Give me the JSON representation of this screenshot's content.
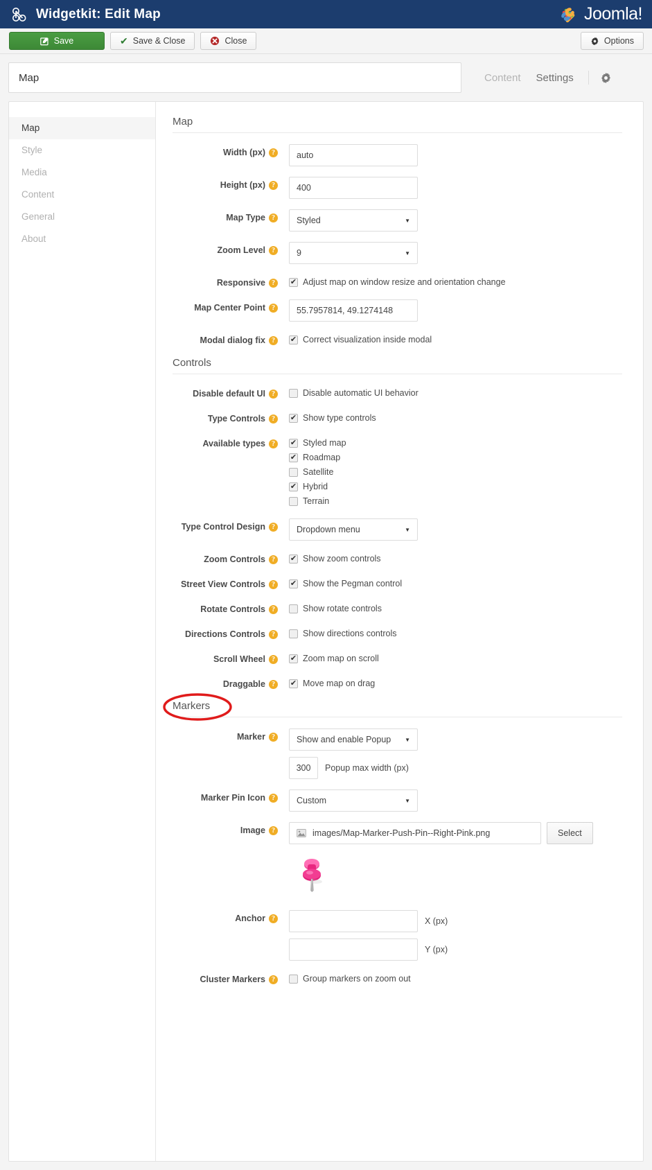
{
  "header": {
    "app_title": "Widgetkit: Edit Map",
    "brand": "Joomla!",
    "brand_mark": "joomla-logo-icon",
    "widgetkit_icon": "widgetkit-icon"
  },
  "toolbar": {
    "save_label": "Save",
    "save_close_label": "Save & Close",
    "close_label": "Close",
    "options_label": "Options"
  },
  "titlebar": {
    "value": "Map",
    "tabs": [
      {
        "label": "Content",
        "active": false
      },
      {
        "label": "Settings",
        "active": true
      }
    ],
    "gear_icon": "gear-icon"
  },
  "sidebar": {
    "items": [
      {
        "label": "Map",
        "active": true
      },
      {
        "label": "Style",
        "active": false
      },
      {
        "label": "Media",
        "active": false
      },
      {
        "label": "Content",
        "active": false
      },
      {
        "label": "General",
        "active": false
      },
      {
        "label": "About",
        "active": false
      }
    ]
  },
  "annotation": {
    "shape": "ellipse",
    "color": "#e01b1b",
    "target": "Markers"
  },
  "sections": {
    "map": {
      "title": "Map",
      "width_label": "Width (px)",
      "width_value": "auto",
      "height_label": "Height (px)",
      "height_value": "400",
      "map_type_label": "Map Type",
      "map_type_value": "Styled",
      "zoom_level_label": "Zoom Level",
      "zoom_level_value": "9",
      "responsive_label": "Responsive",
      "responsive_text": "Adjust map on window resize and orientation change",
      "responsive_checked": true,
      "center_label": "Map Center Point",
      "center_value": "55.7957814, 49.1274148",
      "modal_label": "Modal dialog fix",
      "modal_text": "Correct visualization inside modal",
      "modal_checked": true
    },
    "controls": {
      "title": "Controls",
      "disable_ui_label": "Disable default UI",
      "disable_ui_text": "Disable automatic UI behavior",
      "disable_ui_checked": false,
      "type_controls_label": "Type Controls",
      "type_controls_text": "Show type controls",
      "type_controls_checked": true,
      "available_types_label": "Available types",
      "available_types": [
        {
          "label": "Styled map",
          "checked": true
        },
        {
          "label": "Roadmap",
          "checked": true
        },
        {
          "label": "Satellite",
          "checked": false
        },
        {
          "label": "Hybrid",
          "checked": true
        },
        {
          "label": "Terrain",
          "checked": false
        }
      ],
      "type_design_label": "Type Control Design",
      "type_design_value": "Dropdown menu",
      "zoom_controls_label": "Zoom Controls",
      "zoom_controls_text": "Show zoom controls",
      "zoom_controls_checked": true,
      "street_view_label": "Street View Controls",
      "street_view_text": "Show the Pegman control",
      "street_view_checked": true,
      "rotate_label": "Rotate Controls",
      "rotate_text": "Show rotate controls",
      "rotate_checked": false,
      "directions_label": "Directions Controls",
      "directions_text": "Show directions controls",
      "directions_checked": false,
      "scroll_wheel_label": "Scroll Wheel",
      "scroll_wheel_text": "Zoom map on scroll",
      "scroll_wheel_checked": true,
      "draggable_label": "Draggable",
      "draggable_text": "Move map on drag",
      "draggable_checked": true
    },
    "markers": {
      "title": "Markers",
      "marker_label": "Marker",
      "marker_value": "Show and enable Popup",
      "popup_width_value": "300",
      "popup_width_text": "Popup max width (px)",
      "pin_icon_label": "Marker Pin Icon",
      "pin_icon_value": "Custom",
      "image_label": "Image",
      "image_value": "images/Map-Marker-Push-Pin--Right-Pink.png",
      "image_glyph": "picture-icon",
      "select_label": "Select",
      "preview_icon": "pink-pushpin-preview",
      "anchor_label": "Anchor",
      "anchor_x_value": "",
      "anchor_x_text": "X (px)",
      "anchor_y_value": "",
      "anchor_y_text": "Y (px)",
      "cluster_label": "Cluster Markers",
      "cluster_text": "Group markers on zoom out",
      "cluster_checked": false
    }
  },
  "colors": {
    "header_blue": "#1c3d6e",
    "save_green": "#3d8936",
    "help_orange": "#f0ad25",
    "annotation_red": "#e01b1b",
    "pin_pink": "#ef3d8f"
  }
}
